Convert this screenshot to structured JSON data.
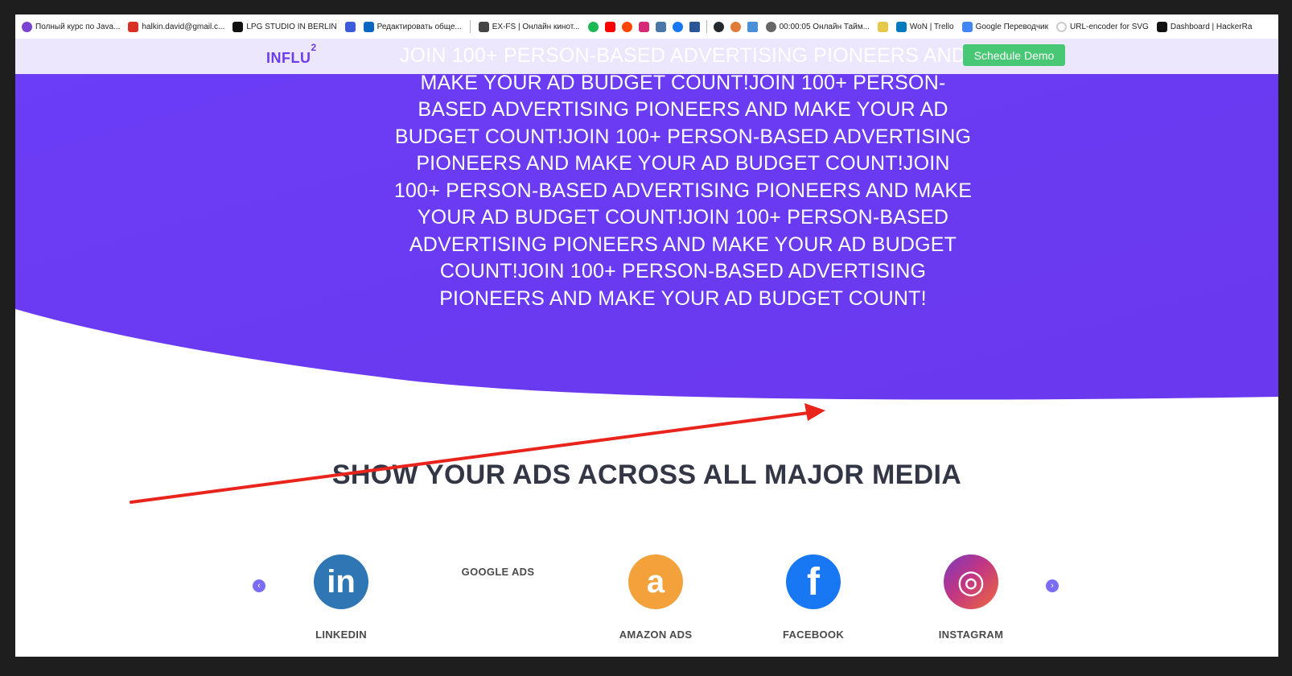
{
  "bookmarks": [
    {
      "label": "Полный курс по Java...",
      "color": "#7b42d1"
    },
    {
      "label": "halkin.david@gmail.c...",
      "color": "#d93025"
    },
    {
      "label": "LPG STUDIO IN BERLIN",
      "color": "#111111"
    },
    {
      "label": "",
      "color": "#3b5bdb"
    },
    {
      "label": "Редактировать обще...",
      "color": "#0a66c2"
    },
    {
      "label": "EX-FS | Онлайн кинот...",
      "color": "#444444"
    },
    {
      "label": "00:00:05 Онлайн Тайм...",
      "color": "#666666"
    },
    {
      "label": "WoN | Trello",
      "color": "#0079bf"
    },
    {
      "label": "Google Переводчик",
      "color": "#4285f4"
    },
    {
      "label": "URL-encoder for SVG",
      "color": "#cccccc"
    },
    {
      "label": "Dashboard | HackerRa",
      "color": "#111111"
    }
  ],
  "bookmark_icons": [
    {
      "name": "spotify-icon",
      "color": "#1db954"
    },
    {
      "name": "youtube-icon",
      "color": "#ff0000"
    },
    {
      "name": "reddit-icon",
      "color": "#ff4500"
    },
    {
      "name": "instagram-icon",
      "color": "#d62976"
    },
    {
      "name": "vk-icon",
      "color": "#4a76a8"
    },
    {
      "name": "facebook-icon",
      "color": "#1877f2"
    },
    {
      "name": "cube-icon",
      "color": "#2b5797"
    },
    {
      "name": "github-icon",
      "color": "#24292e"
    },
    {
      "name": "hand-icon",
      "color": "#e07b3a"
    },
    {
      "name": "puzzle-icon",
      "color": "#4a8fd8"
    }
  ],
  "nav": {
    "logo": "INFLU",
    "logo_sup": "2",
    "demo_label": "Schedule Demo"
  },
  "hero": {
    "text": "JOIN 100+ PERSON-BASED ADVERTISING PIONEERS AND MAKE YOUR AD BUDGET COUNT!JOIN 100+ PERSON-BASED ADVERTISING PIONEERS AND MAKE YOUR AD BUDGET COUNT!JOIN 100+ PERSON-BASED ADVERTISING PIONEERS AND MAKE YOUR AD BUDGET COUNT!JOIN 100+ PERSON-BASED ADVERTISING PIONEERS AND MAKE YOUR AD BUDGET COUNT!JOIN 100+ PERSON-BASED ADVERTISING PIONEERS AND MAKE YOUR AD BUDGET COUNT!JOIN 100+ PERSON-BASED ADVERTISING PIONEERS AND MAKE YOUR AD BUDGET COUNT!",
    "bg_color": "#6a3cf5"
  },
  "section": {
    "title": "SHOW YOUR ADS ACROSS ALL MAJOR MEDIA"
  },
  "carousel": {
    "prev": "‹",
    "next": "›",
    "google_label": "GOOGLE ADS",
    "items": [
      {
        "label": "LINKEDIN",
        "glyph": "in",
        "color": "#2f76b5"
      },
      {
        "label": "AMAZON ADS",
        "glyph": "a",
        "color": "#f3a13a"
      },
      {
        "label": "FACEBOOK",
        "glyph": "f",
        "color": "#1877f2"
      },
      {
        "label": "INSTAGRAM",
        "glyph": "◎",
        "color": "#c13584"
      }
    ]
  },
  "annotation_color": "#e8241c"
}
